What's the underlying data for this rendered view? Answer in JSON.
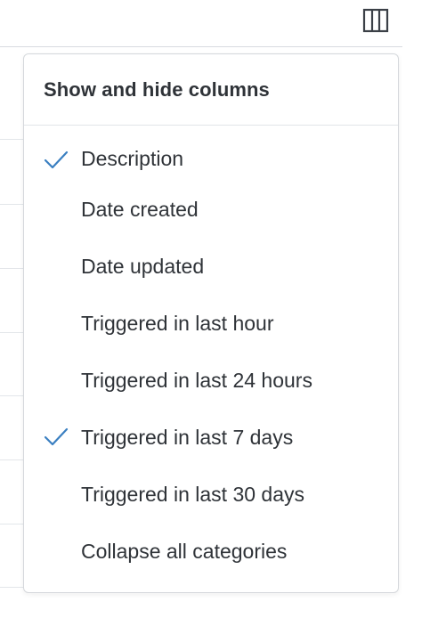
{
  "toolbar": {
    "columns_icon": "columns-icon"
  },
  "popover": {
    "title": "Show and hide columns",
    "items": [
      {
        "label": "Description",
        "checked": true
      },
      {
        "label": "Date created",
        "checked": false
      },
      {
        "label": "Date updated",
        "checked": false
      },
      {
        "label": "Triggered in last hour",
        "checked": false
      },
      {
        "label": "Triggered in last 24 hours",
        "checked": false
      },
      {
        "label": "Triggered in last 7 days",
        "checked": true
      },
      {
        "label": "Triggered in last 30 days",
        "checked": false
      },
      {
        "label": "Collapse all categories",
        "checked": false
      }
    ],
    "check_icon": "checkmark-icon"
  },
  "colors": {
    "accent": "#3a7fc1",
    "text": "#2f3338",
    "border": "#d5d8dc",
    "icon": "#3b4047"
  }
}
